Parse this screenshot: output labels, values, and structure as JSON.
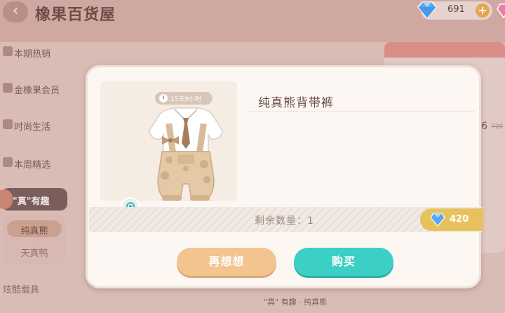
{
  "header": {
    "back_icon": "back-arrow-icon",
    "title": "橡果百货屋",
    "currency_amount": "691",
    "plus_label": "+"
  },
  "sidebar": {
    "items": [
      {
        "label": "本期热销",
        "icon": "fire-icon"
      },
      {
        "label": "金橡果会员",
        "icon": "acorn-icon"
      },
      {
        "label": "时尚生活",
        "icon": "fashion-icon"
      },
      {
        "label": "本周精选",
        "icon": "star-icon"
      }
    ],
    "active": "\"真\"有趣",
    "sub_selected": "纯真熊",
    "sub_other": "天真鸭",
    "last": "炫酷载具"
  },
  "background": {
    "price": "6",
    "price_old": "720",
    "bottom_label": "\"真\" 有趣 · 纯真熊"
  },
  "modal": {
    "timer": "15天9小时",
    "item_name": "纯真熊背带裤",
    "stock_text": "剩余数量：1",
    "price": "420",
    "rethink_label": "再想想",
    "buy_label": "购买"
  },
  "colors": {
    "buy": "#3ccfc6",
    "rethink": "#f2c48f",
    "price_tag": "#e7c25c",
    "gem": "#5aa8f0"
  }
}
